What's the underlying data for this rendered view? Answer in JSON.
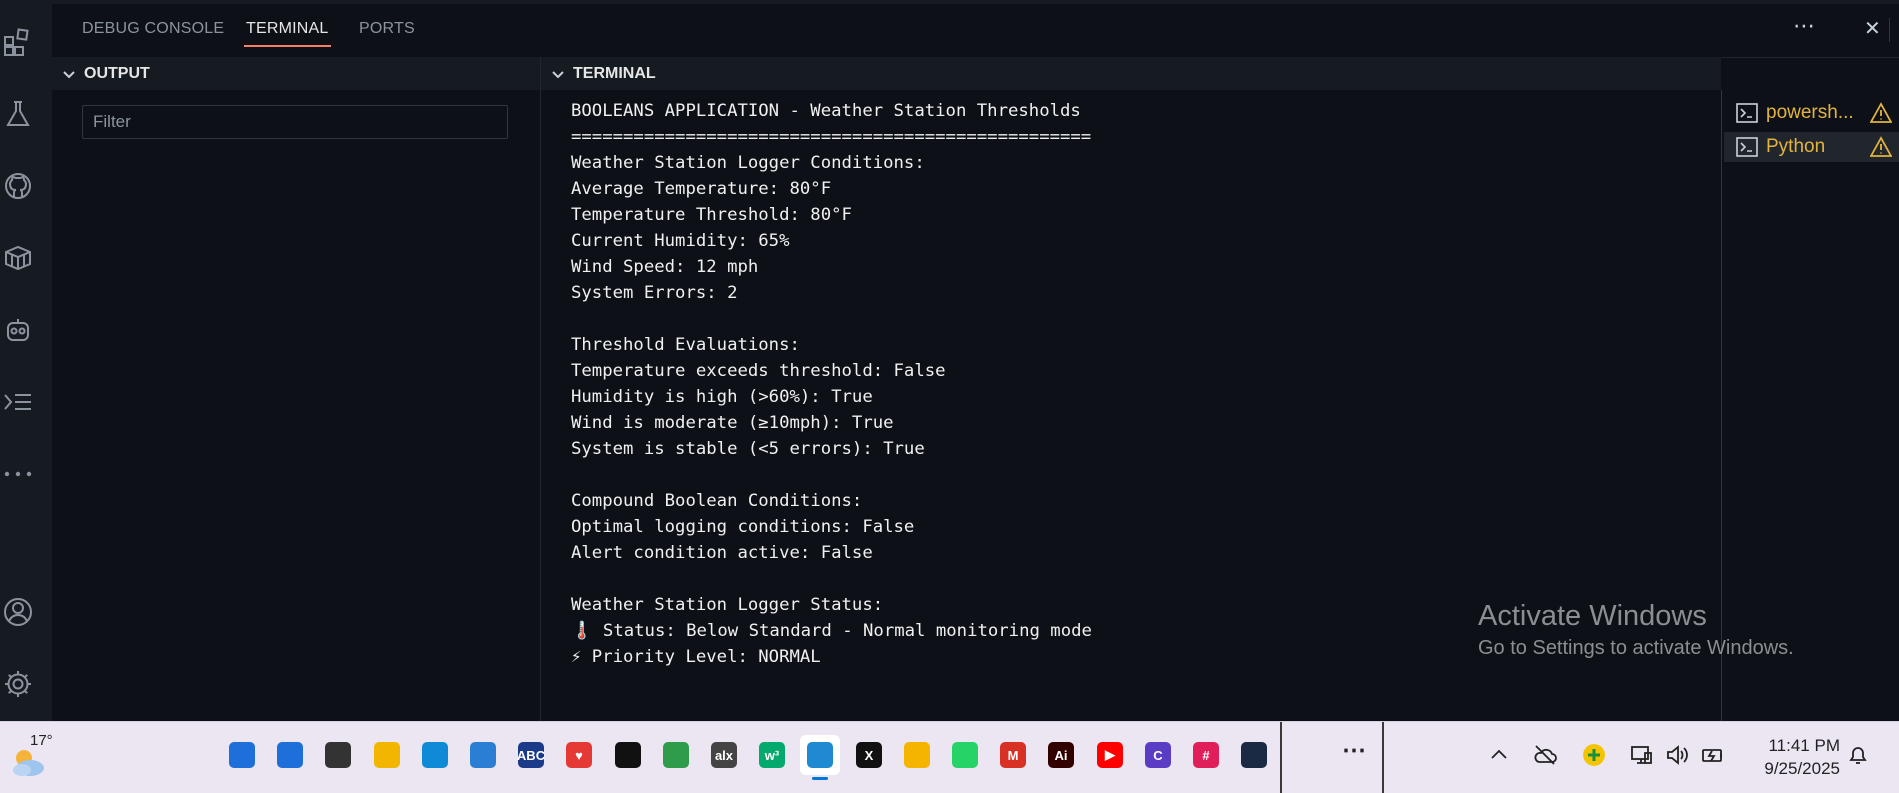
{
  "panel": {
    "tabs": [
      {
        "label": "DEBUG CONSOLE"
      },
      {
        "label": "TERMINAL"
      },
      {
        "label": "PORTS"
      }
    ],
    "more_label": "⋯",
    "close_label": "✕"
  },
  "output": {
    "title": "OUTPUT",
    "filter_placeholder": "Filter"
  },
  "terminal": {
    "title": "TERMINAL",
    "lines": [
      "BOOLEANS APPLICATION - Weather Station Thresholds",
      "==================================================",
      "Weather Station Logger Conditions:",
      "Average Temperature: 80°F",
      "Temperature Threshold: 80°F",
      "Current Humidity: 65%",
      "Wind Speed: 12 mph",
      "System Errors: 2",
      "",
      "Threshold Evaluations:",
      "Temperature exceeds threshold: False",
      "Humidity is high (>60%): True",
      "Wind is moderate (≥10mph): True",
      "System is stable (<5 errors): True",
      "",
      "Compound Boolean Conditions:",
      "Optimal logging conditions: False",
      "Alert condition active: False",
      "",
      "Weather Station Logger Status:",
      "🌡️ Status: Below Standard - Normal monitoring mode",
      "⚡ Priority Level: NORMAL"
    ],
    "instances": [
      {
        "label": "powersh...",
        "icon": "terminal-prompt-icon",
        "warning": true,
        "selected": false
      },
      {
        "label": "Python",
        "icon": "terminal-prompt-icon",
        "warning": true,
        "selected": true
      }
    ]
  },
  "watermark": {
    "line1": "Activate Windows",
    "line2": "Go to Settings to activate Windows."
  },
  "taskbar": {
    "weather_temp": "17°",
    "apps": [
      {
        "name": "start",
        "glyph": "",
        "color": "#1e6fd9"
      },
      {
        "name": "search",
        "glyph": "",
        "color": "#1e6fd9"
      },
      {
        "name": "task-view",
        "glyph": "",
        "color": "#333333"
      },
      {
        "name": "file-explorer",
        "glyph": "",
        "color": "#f2b600"
      },
      {
        "name": "edge",
        "glyph": "",
        "color": "#0f8ad6"
      },
      {
        "name": "store",
        "glyph": "",
        "color": "#2a7fd4"
      },
      {
        "name": "app-abc",
        "glyph": "ABC",
        "color": "#1b3a8a"
      },
      {
        "name": "app-heart",
        "glyph": "♥",
        "color": "#e53935"
      },
      {
        "name": "github",
        "glyph": "",
        "color": "#111111"
      },
      {
        "name": "chrome",
        "glyph": "",
        "color": "#2e9c4a"
      },
      {
        "name": "alx",
        "glyph": "alx",
        "color": "#444444"
      },
      {
        "name": "w3schools",
        "glyph": "w³",
        "color": "#04aa6d"
      },
      {
        "name": "vscode",
        "glyph": "",
        "color": "#1f8ad2"
      },
      {
        "name": "x",
        "glyph": "X",
        "color": "#111111"
      },
      {
        "name": "google-drive",
        "glyph": "",
        "color": "#f5b400"
      },
      {
        "name": "whatsapp",
        "glyph": "",
        "color": "#25d366"
      },
      {
        "name": "gmail",
        "glyph": "M",
        "color": "#d93025"
      },
      {
        "name": "illustrator",
        "glyph": "Ai",
        "color": "#330000"
      },
      {
        "name": "youtube",
        "glyph": "▶",
        "color": "#ff0000"
      },
      {
        "name": "canva",
        "glyph": "C",
        "color": "#5b3cc4"
      },
      {
        "name": "slack",
        "glyph": "#",
        "color": "#e01e5a"
      },
      {
        "name": "app-alx-dark",
        "glyph": "",
        "color": "#1a2a44"
      }
    ],
    "overflow_label": "⋯",
    "time": "11:41 PM",
    "date": "9/25/2025"
  }
}
